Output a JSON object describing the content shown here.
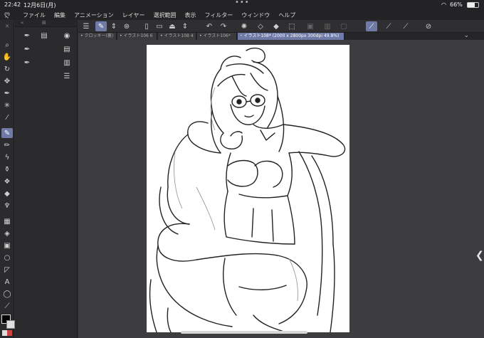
{
  "status": {
    "time": "22:42",
    "date": "12月6日(月)",
    "battery": "66%",
    "battery_level": 0.66
  },
  "menu": {
    "items": [
      "ファイル",
      "編集",
      "アニメーション",
      "レイヤー",
      "選択範囲",
      "表示",
      "フィルター",
      "ウィンドウ",
      "ヘルプ"
    ]
  },
  "tabs": [
    {
      "label": "クロッキー(裏)"
    },
    {
      "label": "イラスト106 6"
    },
    {
      "label": "イラスト108 4"
    },
    {
      "label": "イラスト106*"
    },
    {
      "label": "イラスト108* (2000 x 2800px 300dpi 49.8%)"
    }
  ],
  "icons": {
    "tools": [
      "magnifier-icon",
      "hand-icon",
      "rotate-icon",
      "move-icon",
      "pen-nib-icon",
      "magic-wand-icon",
      "eyedropper-icon",
      "pen-icon",
      "pencil-icon",
      "brush-icon",
      "airbrush-icon",
      "decoration-icon",
      "eraser-icon",
      "blend-icon",
      "figure-icon",
      "frame-icon",
      "fill-icon",
      "gradient-icon",
      "ellipse-icon",
      "ruler-icon",
      "text-icon",
      "lasso-icon",
      "correction-icon"
    ]
  },
  "colors": {
    "accent": "#6f7aa6",
    "background": "#2e2e30",
    "canvas_bg": "#3d3d3f",
    "paper": "#ffffff",
    "main_color": "#000000",
    "sub_color": "#e0e0e0"
  }
}
